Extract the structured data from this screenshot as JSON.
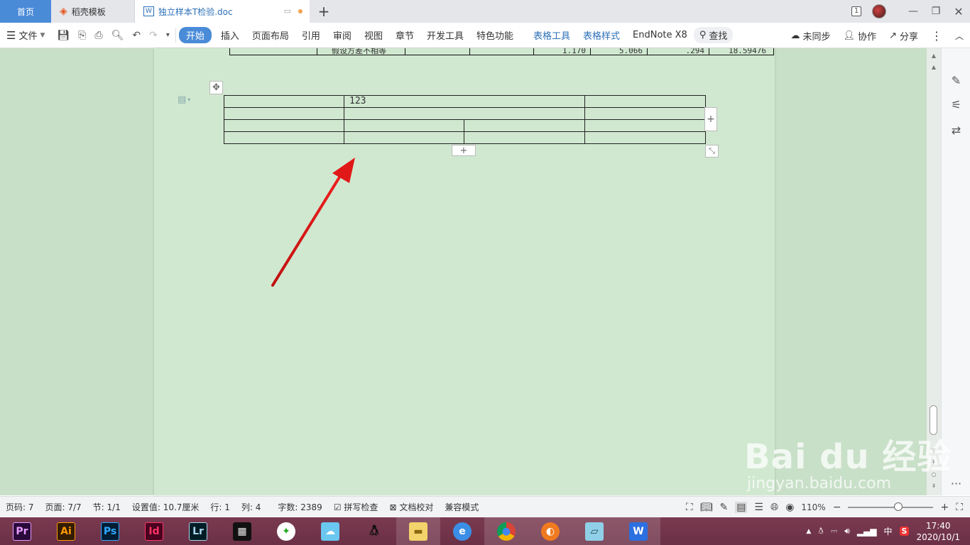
{
  "tabs": {
    "home": "首页",
    "templates": "稻壳模板",
    "document": "独立样本T检验.doc"
  },
  "window": {
    "badge": "1"
  },
  "ribbon": {
    "file": "文件",
    "items": [
      "开始",
      "插入",
      "页面布局",
      "引用",
      "审阅",
      "视图",
      "章节",
      "开发工具",
      "特色功能"
    ],
    "context_items": [
      "表格工具",
      "表格样式"
    ],
    "endnote": "EndNote X8",
    "search": "查找",
    "sync": "未同步",
    "collab": "协作",
    "share": "分享"
  },
  "document": {
    "prev_table_row": [
      "假设方差不相等",
      "",
      "",
      "1.170",
      "5.066",
      ".294",
      "18.59476"
    ],
    "table_cell_text": "123"
  },
  "status": {
    "page_num": "页码: 7",
    "pages": "页面: 7/7",
    "section": "节: 1/1",
    "setting": "设置值: 10.7厘米",
    "row": "行: 1",
    "col": "列: 4",
    "words": "字数: 2389",
    "spell": "拼写检查",
    "proof": "文档校对",
    "compat": "兼容模式",
    "zoom": "110%"
  },
  "taskbar": {
    "apps": [
      "Pr",
      "Ai",
      "Ps",
      "Id",
      "Lr"
    ],
    "ime": "中",
    "time": "17:40",
    "date": "2020/10/1"
  },
  "watermark": {
    "brand": "Bai du 经验",
    "url": "jingyan.baidu.com"
  }
}
